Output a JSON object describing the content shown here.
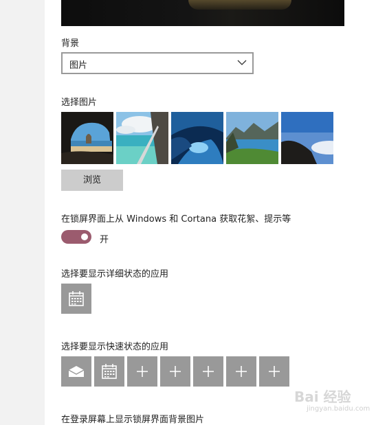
{
  "preview": {
    "description_icon": "lock-screen-preview"
  },
  "background": {
    "label": "背景",
    "selected": "图片"
  },
  "choose_picture": {
    "label": "选择图片",
    "thumbnails": [
      "cave-beach",
      "beach-rock",
      "ice-cave",
      "mountain-lake",
      "cliff-sunrise"
    ],
    "browse_label": "浏览"
  },
  "fun_facts": {
    "label": "在锁屏界面上从 Windows 和 Cortana 获取花絮、提示等",
    "state": "开",
    "accent": "#9b5b6e"
  },
  "detailed_status": {
    "label": "选择要显示详细状态的应用",
    "apps": [
      "calendar-icon"
    ]
  },
  "quick_status": {
    "label": "选择要显示快速状态的应用",
    "apps": [
      "mail-icon",
      "calendar-icon",
      "plus-icon",
      "plus-icon",
      "plus-icon",
      "plus-icon",
      "plus-icon"
    ]
  },
  "signin_background": {
    "label": "在登录屏幕上显示锁屏界面背景图片"
  },
  "watermark": {
    "big": "Bai 经验",
    "small": "jingyan.baidu.com"
  }
}
